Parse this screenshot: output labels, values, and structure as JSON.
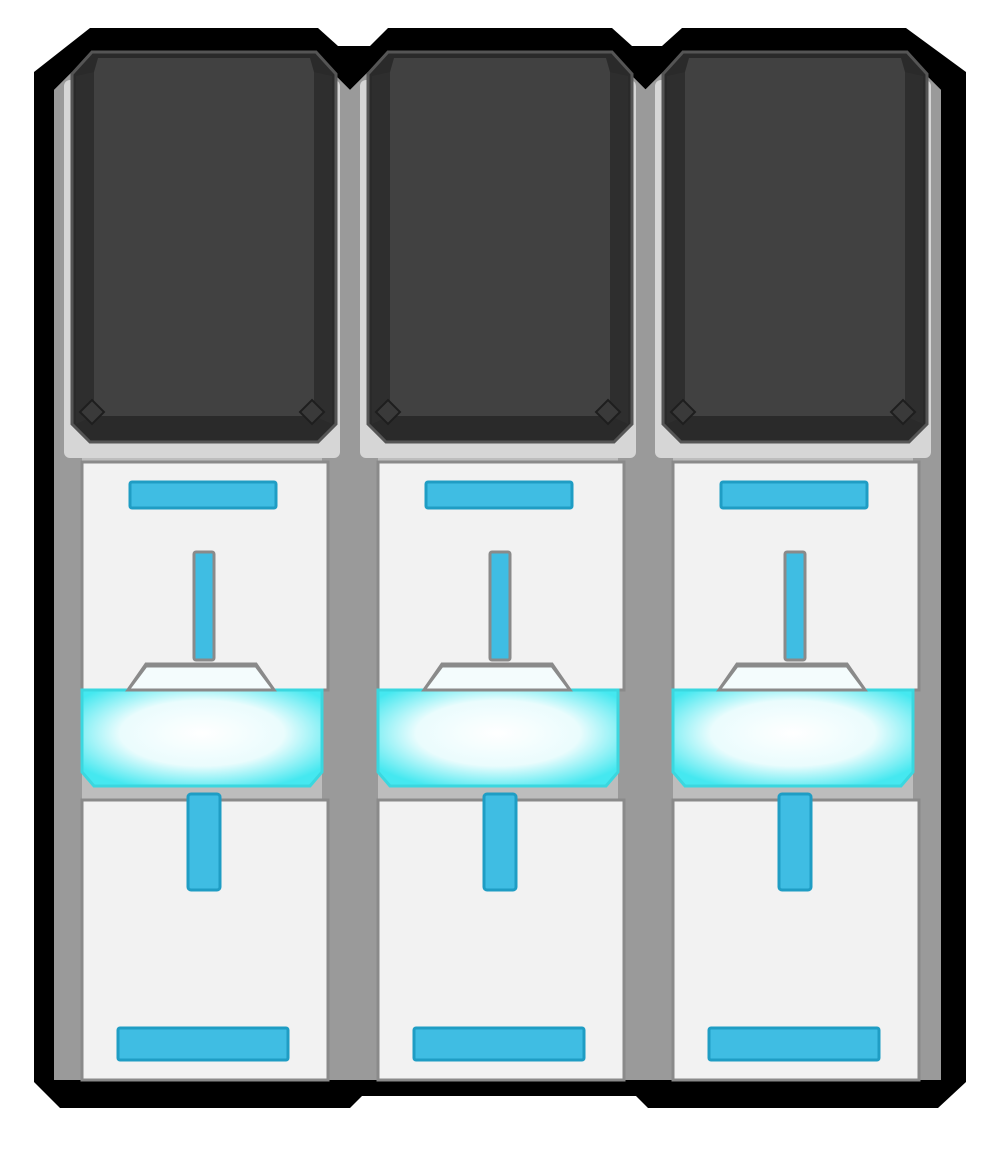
{
  "sprite": {
    "kind": "sci-fi server rack / cryo pod tiles",
    "columns": 3,
    "modules": [
      {
        "id": "pod-1",
        "screen": "dark",
        "light": "on"
      },
      {
        "id": "pod-2",
        "screen": "dark",
        "light": "on"
      },
      {
        "id": "pod-3",
        "screen": "dark",
        "light": "on"
      }
    ]
  },
  "palette": {
    "outline": "#000000",
    "frame_light": "#d6d6d6",
    "frame_mid": "#bdbdbd",
    "frame_dark": "#9a9a9a",
    "screen_face": "#414141",
    "screen_side": "#2e2e2e",
    "screen_edge": "#2a2a2a",
    "panel": "#f2f2f2",
    "panel_line": "#8a8a8a",
    "accent": "#3fbde3",
    "accent_edge": "#1f9dc4",
    "glow_edge": "#45e8f0",
    "glow_core": "#ffffff"
  }
}
